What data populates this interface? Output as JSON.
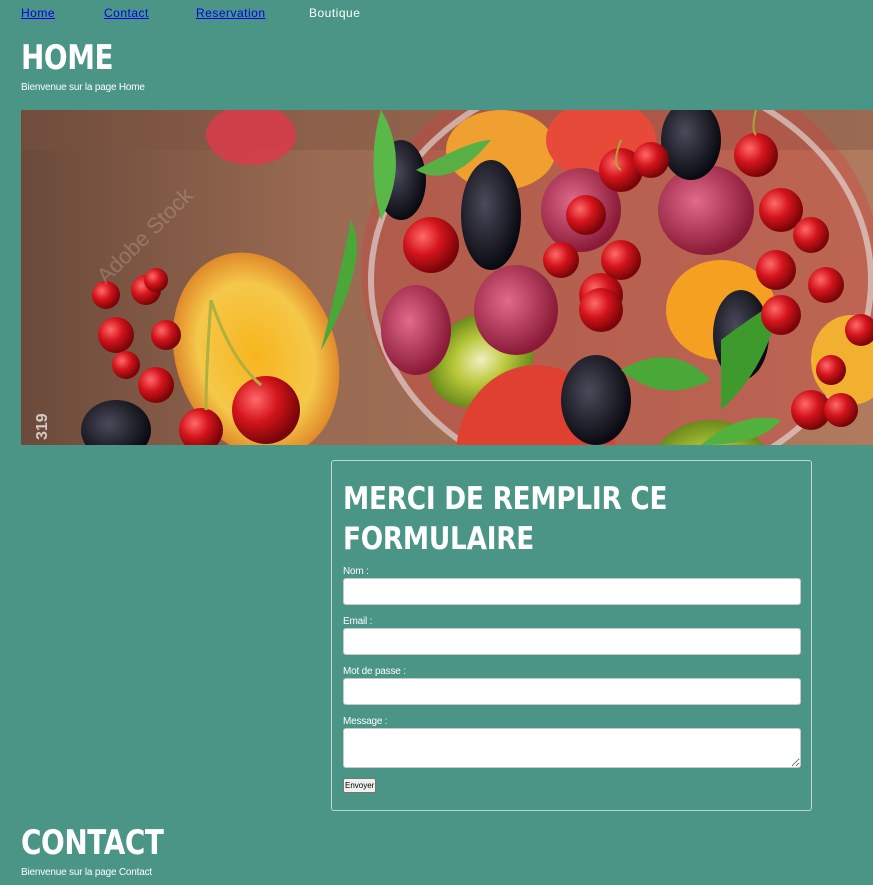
{
  "nav": {
    "items": [
      {
        "label": "Home",
        "current": false
      },
      {
        "label": "Contact",
        "current": false
      },
      {
        "label": "Reservation",
        "current": false
      },
      {
        "label": "Boutique",
        "current": true
      }
    ]
  },
  "home": {
    "title": "HOME",
    "subtitle": "Bienvenue sur la page Home"
  },
  "banner": {
    "watermark": "Adobe Stock",
    "stock_id": "319"
  },
  "form": {
    "title": "MERCI DE REMPLIR CE FORMULAIRE",
    "fields": [
      {
        "label": "Nom :",
        "value": "",
        "placeholder": ""
      },
      {
        "label": "Email :",
        "value": "",
        "placeholder": ""
      },
      {
        "label": "Mot de passe :",
        "value": "",
        "placeholder": ""
      },
      {
        "label": "Message :",
        "value": "",
        "placeholder": ""
      }
    ],
    "submit_label": "Envoyer"
  },
  "contact": {
    "title": "CONTACT",
    "subtitle": "Bienvenue sur la page Contact"
  },
  "colors": {
    "background": "#4a9585",
    "link": "#0000ee",
    "text": "#ffffff"
  }
}
